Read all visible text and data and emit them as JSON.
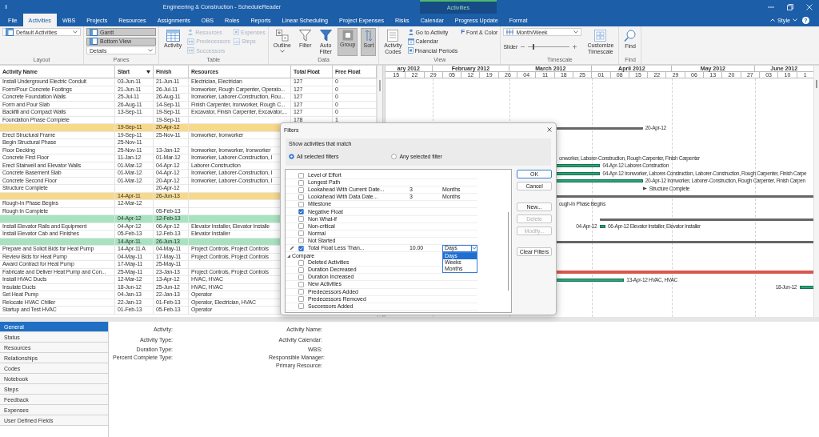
{
  "window": {
    "title": "Engineering & Construction - ScheduleReader",
    "context_tab": "Activities"
  },
  "tabs": [
    {
      "label": "File",
      "selected": false
    },
    {
      "label": "Activities",
      "selected": true
    },
    {
      "label": "WBS",
      "selected": false
    },
    {
      "label": "Projects",
      "selected": false
    },
    {
      "label": "Resources",
      "selected": false
    },
    {
      "label": "Assignments",
      "selected": false
    },
    {
      "label": "OBS",
      "selected": false
    },
    {
      "label": "Roles",
      "selected": false
    },
    {
      "label": "Reports",
      "selected": false
    },
    {
      "label": "Linear Scheduling",
      "selected": false
    },
    {
      "label": "Project Expenses",
      "selected": false
    },
    {
      "label": "Risks",
      "selected": false
    },
    {
      "label": "Calendar",
      "selected": false
    },
    {
      "label": "Progress Update",
      "selected": false
    },
    {
      "label": "Format",
      "selected": false
    }
  ],
  "style_menu": {
    "label": "Style",
    "help": "?"
  },
  "ribbon": {
    "groups": [
      {
        "label": "Layout",
        "columns": [
          [
            {
              "kind": "dropdown",
              "value": "Default Activities"
            }
          ]
        ]
      },
      {
        "label": "Panes",
        "columns": [
          [
            {
              "kind": "toggle",
              "label": "Gantt",
              "selected": true
            },
            {
              "kind": "toggle",
              "label": "Bottom View",
              "selected": true
            },
            {
              "kind": "dropdown",
              "value": "Details"
            }
          ]
        ]
      },
      {
        "label": "Table",
        "columns": [
          [
            {
              "kind": "large",
              "label": "Activity",
              "selected": false
            }
          ],
          [
            {
              "kind": "small",
              "label": "Resources",
              "disabled": true
            },
            {
              "kind": "small",
              "label": "Predecessors",
              "disabled": true
            },
            {
              "kind": "small",
              "label": "Successors",
              "disabled": true
            }
          ],
          [
            {
              "kind": "small",
              "label": "Expenses",
              "disabled": true
            },
            {
              "kind": "small",
              "label": "Steps",
              "disabled": true
            }
          ]
        ]
      },
      {
        "label": "Data",
        "columns": [
          [
            {
              "kind": "large",
              "label": "Outline",
              "selected": false,
              "menu": true
            }
          ],
          [
            {
              "kind": "large",
              "label": "Filter",
              "selected": false
            }
          ],
          [
            {
              "kind": "large",
              "label": "Auto Filter",
              "selected": false
            }
          ],
          [
            {
              "kind": "large",
              "label": "Group",
              "selected": true
            }
          ],
          [
            {
              "kind": "large",
              "label": "Sort",
              "selected": true
            }
          ]
        ]
      },
      {
        "label": "View",
        "columns": [
          [
            {
              "kind": "large",
              "label": "Activity Codes",
              "selected": false
            }
          ],
          [
            {
              "kind": "small",
              "label": "Go to Activity",
              "disabled": false
            },
            {
              "kind": "small",
              "label": "Calendar",
              "disabled": false
            },
            {
              "kind": "small",
              "label": "Financial Periods",
              "disabled": false
            }
          ],
          [
            {
              "kind": "small",
              "label": "Font & Color",
              "glyph": "F",
              "disabled": false
            }
          ]
        ]
      },
      {
        "label": "Timescale",
        "columns": [
          [
            {
              "kind": "dropdown",
              "value": "Month/Week"
            },
            {
              "kind": "slider",
              "label": "Slider",
              "level": 0.13
            }
          ],
          [
            {
              "kind": "large",
              "label": "Customize Timescale",
              "selected": false
            }
          ]
        ]
      },
      {
        "label": "Find",
        "columns": [
          [
            {
              "kind": "large",
              "label": "Find",
              "selected": false
            }
          ]
        ]
      }
    ]
  },
  "table": {
    "columns": [
      {
        "label": "Activity Name",
        "sorted": false
      },
      {
        "label": "Start",
        "sorted": true
      },
      {
        "label": "Finish",
        "sorted": false
      },
      {
        "label": "Resources",
        "sorted": false
      },
      {
        "label": "Total Float",
        "sorted": false
      },
      {
        "label": "Free Float",
        "sorted": false
      }
    ],
    "rows": [
      {
        "kind": "activity",
        "name": "Install Underground Electric Conduit",
        "start": "03-Jun-11",
        "finish": "21-Jun-11",
        "resources": "Electrician, Electrician",
        "total_float": "127",
        "free_float": "0"
      },
      {
        "kind": "activity",
        "name": "Form/Pour Concrete Footings",
        "start": "21-Jun-11",
        "finish": "26-Jul-11",
        "resources": "Ironworker, Rough Carpenter, Operato...",
        "total_float": "127",
        "free_float": "0"
      },
      {
        "kind": "activity",
        "name": "Concrete Foundation Walls",
        "start": "25-Jul-11",
        "finish": "26-Aug-11",
        "resources": "Ironworker, Laborer-Construction, Rou...",
        "total_float": "127",
        "free_float": "0"
      },
      {
        "kind": "activity",
        "name": "Form and Pour Slab",
        "start": "26-Aug-11",
        "finish": "14-Sep-11",
        "resources": "Finish Carpenter, Ironworker, Rough C...",
        "total_float": "127",
        "free_float": "0"
      },
      {
        "kind": "activity",
        "name": "Backfill and Compact Walls",
        "start": "13-Sep-11",
        "finish": "19-Sep-11",
        "resources": "Excavator, Finish Carpenter, Excavator,...",
        "total_float": "127",
        "free_float": "0"
      },
      {
        "kind": "activity",
        "name": "Foundation Phase Complete",
        "finish": "19-Sep-11",
        "total_float": "178",
        "free_float": "1"
      },
      {
        "kind": "wbs",
        "color": "#f8d98a",
        "start": "19-Sep-11",
        "finish": "20-Apr-12",
        "bar": {
          "kind": "summary"
        },
        "bar_label": "20-Apr-12"
      },
      {
        "kind": "activity",
        "name": "Erect Structural Frame",
        "start": "19-Sep-11",
        "finish": "25-Nov-11",
        "resources": "Ironworker, Ironworker"
      },
      {
        "kind": "activity",
        "name": "Begin Structural Phase",
        "start": "25-Nov-11"
      },
      {
        "kind": "activity",
        "name": "Floor Decking",
        "start": "25-Nov-11",
        "finish": "13-Jan-12",
        "resources": "Ironworker, Ironworker, Ironworker"
      },
      {
        "kind": "activity",
        "name": "Concrete First Floor",
        "start": "11-Jan-12",
        "finish": "01-Mar-12",
        "resources": "Ironworker, Laborer-Construction, I",
        "bar_label": "onworker, Laborer-Construction, Rough Carpenter, Finish Carpenter"
      },
      {
        "kind": "activity",
        "name": "Erect Stairwell and Elevator Walls",
        "start": "01-Mar-12",
        "finish": "04-Apr-12",
        "resources": "Laborer-Construction",
        "bar": {
          "kind": "task"
        },
        "bar_label": "04-Apr-12  Laborer-Construction"
      },
      {
        "kind": "activity",
        "name": "Concrete Basement Slab",
        "start": "01-Mar-12",
        "finish": "04-Apr-12",
        "resources": "Ironworker, Laborer-Construction, I",
        "bar": {
          "kind": "task"
        },
        "bar_label": "04-Apr-12  Ironworker, Laborer-Construction, Laborer-Construction, Rough Carpenter, Finish Carpe"
      },
      {
        "kind": "activity",
        "name": "Concrete Second Floor",
        "start": "01-Mar-12",
        "finish": "20-Apr-12",
        "resources": "Ironworker, Laborer-Construction, I",
        "bar": {
          "kind": "task"
        },
        "bar_label": "20-Apr-12   Ironworker, Laborer-Construction, Rough Carpenter, Finish Carpen"
      },
      {
        "kind": "activity",
        "name": "Structure Complete",
        "finish": "20-Apr-12",
        "bar": {
          "kind": "milestone"
        },
        "bar_label": "Structure Complete"
      },
      {
        "kind": "wbs",
        "color": "#f8d98a",
        "start": "14-Apr-11",
        "finish": "26-Jun-13",
        "bar": {
          "kind": "summary"
        }
      },
      {
        "kind": "activity",
        "name": "Rough-In Phase Begins",
        "start": "12-Mar-12",
        "bar_label": "ough-In Phase Begins"
      },
      {
        "kind": "activity",
        "name": "Rough In Complete",
        "finish": "05-Feb-13"
      },
      {
        "kind": "wbs",
        "color": "#a8e3c0",
        "start": "04-Apr-12",
        "finish": "12-Feb-13",
        "bar": {
          "kind": "summary"
        }
      },
      {
        "kind": "activity",
        "name": "Install Elevator Rails and Equipment",
        "start": "04-Apr-12",
        "finish": "06-Apr-12",
        "resources": "Elevator Installer, Elevator Installe",
        "bar": {
          "kind": "task"
        },
        "bar_left_label": "04-Apr-12",
        "bar_label": "06-Apr-12  Elevator Installer, Elevator Installer"
      },
      {
        "kind": "activity",
        "name": "Install Elevator Cab and Finishes",
        "start": "05-Feb-13",
        "finish": "12-Feb-13",
        "resources": "Elevator Installer"
      },
      {
        "kind": "wbs",
        "color": "#a8e3c0",
        "start": "14-Apr-11",
        "finish": "26-Jun-13",
        "bar": {
          "kind": "summary"
        }
      },
      {
        "kind": "activity",
        "name": "Prepare and Solicit Bids for Heat Pump",
        "start": "14-Apr-11 A",
        "finish": "04-May-11",
        "resources": "Project Controls, Project Controls"
      },
      {
        "kind": "activity",
        "name": "Review Bids for Heat Pump",
        "start": "04-May-11",
        "finish": "17-May-11",
        "resources": "Project Controls, Project Controls"
      },
      {
        "kind": "activity",
        "name": "Award Contract for Heat Pump",
        "start": "17-May-11",
        "finish": "25-May-11"
      },
      {
        "kind": "activity",
        "name": "Fabricate and Deliver Heat Pump and Con...",
        "start": "25-May-11",
        "finish": "23-Jan-13",
        "resources": "Project Controls, Project Controls",
        "bar": {
          "kind": "critical"
        }
      },
      {
        "kind": "activity",
        "name": "Install HVAC Ducts",
        "start": "12-Mar-12",
        "finish": "13-Apr-12",
        "resources": "HVAC, HVAC",
        "bar": {
          "kind": "task"
        },
        "bar_label": "13-Apr-12  HVAC, HVAC"
      },
      {
        "kind": "activity",
        "name": "Insulate Ducts",
        "start": "18-Jun-12",
        "finish": "25-Jun-12",
        "resources": "HVAC, HVAC",
        "bar": {
          "kind": "task"
        },
        "bar_left_label": "18-Jun-12"
      },
      {
        "kind": "activity",
        "name": "Set Heat Pump",
        "start": "04-Jan-13",
        "finish": "22-Jan-13",
        "resources": "Operator"
      },
      {
        "kind": "activity",
        "name": "Relocate HVAC Chiller",
        "start": "22-Jan-13",
        "finish": "01-Feb-13",
        "resources": "Operator, Electrician, HVAC"
      },
      {
        "kind": "activity",
        "name": "Startup and Test HVAC",
        "start": "01-Feb-13",
        "finish": "05-Feb-13",
        "resources": "Operator"
      }
    ]
  },
  "gantt": {
    "months": [
      "ary 2012",
      "February 2012",
      "March 2012",
      "April 2012",
      "May 2012",
      "June 2012"
    ],
    "weeks": [
      "15",
      "22",
      "29",
      "05",
      "12",
      "19",
      "26",
      "04",
      "11",
      "18",
      "25",
      "01",
      "08",
      "15",
      "22",
      "29",
      "06",
      "13",
      "20",
      "27",
      "03",
      "10",
      "1"
    ]
  },
  "filters": {
    "title": "Filters",
    "match_label": "Show activities that match",
    "match_options": [
      {
        "label": "All selected filters",
        "selected": true
      },
      {
        "label": "Any selected filter",
        "selected": false
      }
    ],
    "items": [
      {
        "kind": "filter",
        "label": "Level of Effort",
        "checked": false
      },
      {
        "kind": "filter",
        "label": "Longest Path",
        "checked": false
      },
      {
        "kind": "filter",
        "label": "Lookahead With Current Date...",
        "checked": false,
        "value": "3",
        "unit": "Months"
      },
      {
        "kind": "filter",
        "label": "Lookahead With Data Date...",
        "checked": false,
        "value": "3",
        "unit": "Months"
      },
      {
        "kind": "filter",
        "label": "Milestone",
        "checked": false
      },
      {
        "kind": "filter",
        "label": "Negative Float",
        "checked": true
      },
      {
        "kind": "filter",
        "label": "Non What-if",
        "checked": false
      },
      {
        "kind": "filter",
        "label": "Non-critical",
        "checked": false
      },
      {
        "kind": "filter",
        "label": "Normal",
        "checked": false
      },
      {
        "kind": "filter",
        "label": "Not Started",
        "checked": false
      },
      {
        "kind": "filter",
        "label": "Total Float Less Than...",
        "checked": true,
        "editing": true,
        "value": "10.00",
        "unit_select": {
          "value": "Days",
          "open": true,
          "options": [
            {
              "label": "Days",
              "selected": true
            },
            {
              "label": "Weeks",
              "selected": false
            },
            {
              "label": "Months",
              "selected": false
            }
          ]
        }
      },
      {
        "kind": "group",
        "label": "Compare",
        "expanded": true,
        "children": [
          {
            "kind": "filter",
            "label": "Deleted Activities",
            "checked": false
          },
          {
            "kind": "filter",
            "label": "Duration Decreased",
            "checked": false
          },
          {
            "kind": "filter",
            "label": "Duration Increased",
            "checked": false
          },
          {
            "kind": "filter",
            "label": "New Activities",
            "checked": false
          },
          {
            "kind": "filter",
            "label": "Predecessors Added",
            "checked": false
          },
          {
            "kind": "filter",
            "label": "Predecessors Removed",
            "checked": false
          },
          {
            "kind": "filter",
            "label": "Successors Added",
            "checked": false
          }
        ]
      }
    ],
    "button_groups": [
      [
        {
          "label": "OK",
          "default": true,
          "disabled": false
        },
        {
          "label": "Cancel",
          "default": false,
          "disabled": false
        }
      ],
      [
        {
          "label": "New...",
          "default": false,
          "disabled": false
        },
        {
          "label": "Delete",
          "default": false,
          "disabled": true
        },
        {
          "label": "Modify...",
          "default": false,
          "disabled": true
        }
      ],
      [
        {
          "label": "Clear Filters",
          "default": false,
          "disabled": false
        }
      ]
    ]
  },
  "details": {
    "tabs": [
      {
        "label": "General",
        "selected": true
      },
      {
        "label": "Status",
        "selected": false
      },
      {
        "label": "Resources",
        "selected": false
      },
      {
        "label": "Relationships",
        "selected": false
      },
      {
        "label": "Codes",
        "selected": false
      },
      {
        "label": "Notebook",
        "selected": false
      },
      {
        "label": "Steps",
        "selected": false
      },
      {
        "label": "Feedback",
        "selected": false
      },
      {
        "label": "Expenses",
        "selected": false
      },
      {
        "label": "User Defined Fields",
        "selected": false
      }
    ],
    "fields_left": [
      "Activity:",
      "Activity Type:",
      "Duration Type:",
      "Percent Complete Type:"
    ],
    "fields_right": [
      "Activity Name:",
      "Activity Calendar:",
      "WBS:",
      "Responsible Manager:",
      "Primary Resource:"
    ]
  }
}
